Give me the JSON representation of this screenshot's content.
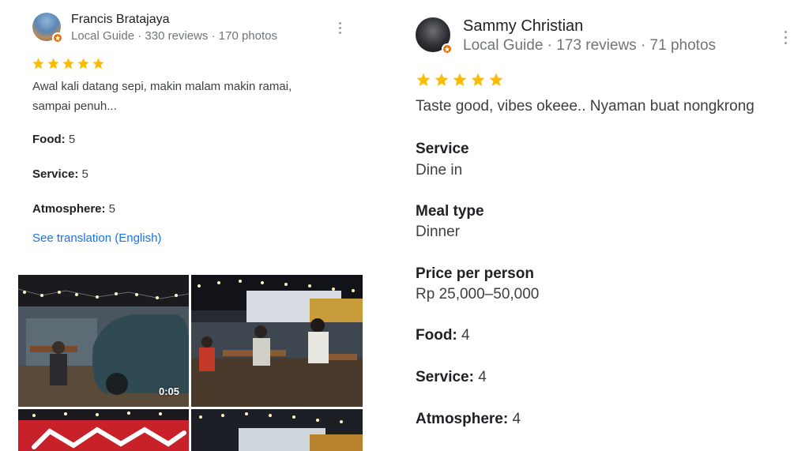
{
  "colors": {
    "star": "#fbbc04",
    "link": "#1a73e8",
    "meta": "#70757a",
    "local_guide_badge": "#e8710a"
  },
  "left_review": {
    "reviewer_name": "Francis Bratajaya",
    "reviewer_meta": "Local Guide · 330 reviews · 170 photos",
    "rating_stars": 5,
    "text_line1": "Awal kali datang sepi, makin malam makin ramai,",
    "text_line2": "sampai penuh...",
    "food_label": "Food:",
    "food_value": " 5",
    "service_label": "Service:",
    "service_value": " 5",
    "atmosphere_label": "Atmosphere:",
    "atmosphere_value": " 5",
    "translate_link": "See translation (English)",
    "photos": [
      {
        "icon": "video-thumbnail",
        "duration": "0:05"
      },
      {
        "icon": "photo-thumbnail"
      },
      {
        "icon": "photo-thumbnail"
      },
      {
        "icon": "photo-thumbnail"
      }
    ]
  },
  "right_review": {
    "reviewer_name": "Sammy Christian",
    "reviewer_meta": "Local Guide · 173 reviews · 71 photos",
    "rating_stars": 5,
    "text": "Taste good, vibes okeee.. Nyaman buat nongkrong",
    "service_label": "Service",
    "service_value": "Dine in",
    "meal_type_label": "Meal type",
    "meal_type_value": "Dinner",
    "price_label": "Price per person",
    "price_value": "Rp 25,000–50,000",
    "food_label": "Food:",
    "food_value": " 4",
    "service_rating_label": "Service:",
    "service_rating_value": " 4",
    "atmosphere_label": "Atmosphere:",
    "atmosphere_value": " 4"
  }
}
